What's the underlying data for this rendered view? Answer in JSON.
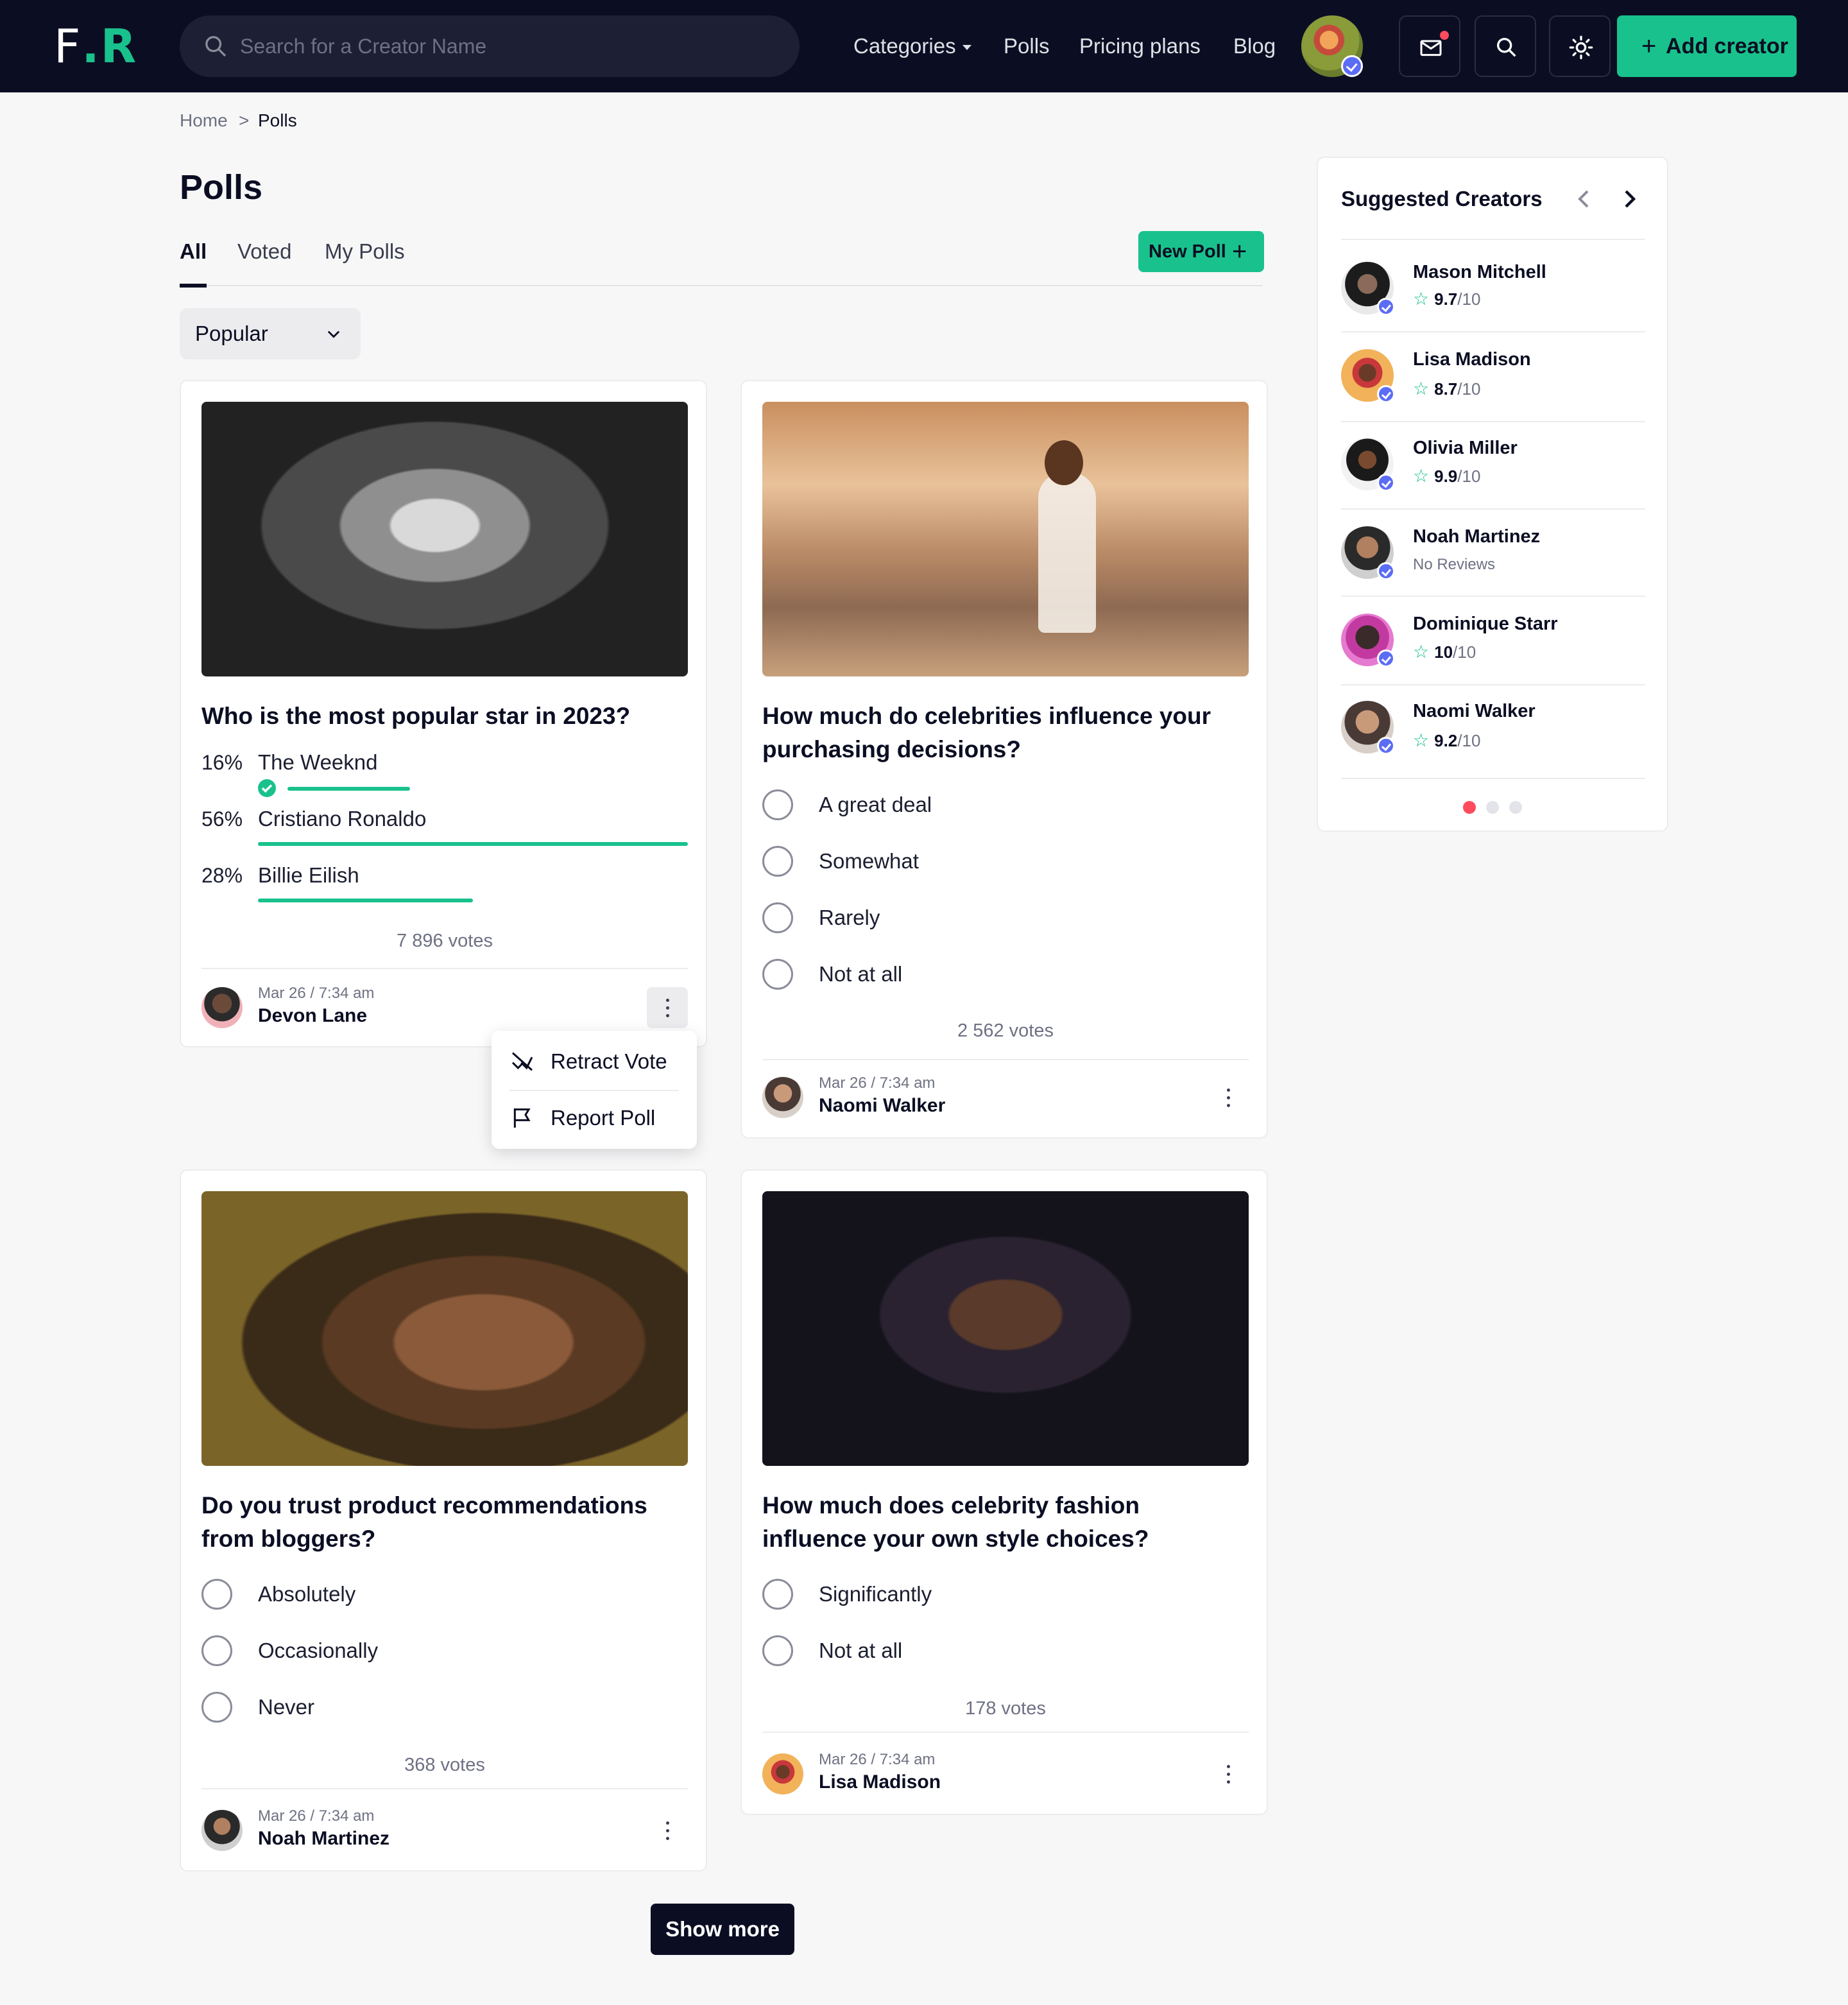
{
  "header": {
    "logo_f": "F",
    "logo_dot": ".",
    "logo_r": "R",
    "search_placeholder": "Search for a Creator Name",
    "nav": [
      {
        "label": "Categories"
      },
      {
        "label": "Polls"
      },
      {
        "label": "Pricing plans"
      },
      {
        "label": "Blog"
      }
    ],
    "add_creator_plus": "+",
    "add_creator_label": "Add creator",
    "icons": [
      "mail-icon",
      "search-icon",
      "theme-sun-icon"
    ],
    "accent": "#19c28c",
    "bg": "#0b0e23"
  },
  "breadcrumb": {
    "home": "Home",
    "separator": ">",
    "current": "Polls"
  },
  "page": {
    "title": "Polls",
    "tabs": [
      {
        "label": "All"
      },
      {
        "label": "Voted"
      },
      {
        "label": "My Polls"
      }
    ],
    "active_tab": "All",
    "new_poll_label": "New Poll",
    "new_poll_plus": "+",
    "sort": {
      "selected": "Popular"
    }
  },
  "polls": [
    {
      "question": "Who is the most popular star in 2023?",
      "voted": true,
      "results": [
        {
          "pct": "16%",
          "label": "The Weeknd",
          "value": 16,
          "my_vote": true
        },
        {
          "pct": "56%",
          "label": "Cristiano Ronaldo",
          "value": 56
        },
        {
          "pct": "28%",
          "label": "Billie Eilish",
          "value": 28
        }
      ],
      "votes": "7 896 votes",
      "date": "Mar 26 / 7:34 am",
      "author": "Devon Lane"
    },
    {
      "question": "How much do celebrities influence your purchasing decisions?",
      "options": [
        "A great deal",
        "Somewhat",
        "Rarely",
        "Not at all"
      ],
      "votes": "2 562 votes",
      "date": "Mar 26 / 7:34 am",
      "author": "Naomi Walker"
    },
    {
      "question": "Do you trust product recommendations from bloggers?",
      "options": [
        "Absolutely",
        "Occasionally",
        "Never"
      ],
      "votes": "368 votes",
      "date": "Mar 26 / 7:34 am",
      "author": "Noah Martinez"
    },
    {
      "question": "How much does celebrity fashion influence your own style choices?",
      "options": [
        "Significantly",
        "Not at all"
      ],
      "votes": "178 votes",
      "date": "Mar 26 / 7:34 am",
      "author": "Lisa Madison"
    }
  ],
  "context_menu": {
    "retract": "Retract Vote",
    "report": "Report Poll"
  },
  "suggested": {
    "title": "Suggested Creators",
    "creators": [
      {
        "name": "Mason Mitchell",
        "rating": "9.7",
        "of": "/10"
      },
      {
        "name": "Lisa Madison",
        "rating": "8.7",
        "of": "/10"
      },
      {
        "name": "Olivia Miller",
        "rating": "9.9",
        "of": "/10"
      },
      {
        "name": "Noah Martinez",
        "no_reviews": "No Reviews"
      },
      {
        "name": "Dominique Starr",
        "rating": "10",
        "of": "/10"
      },
      {
        "name": "Naomi Walker",
        "rating": "9.2",
        "of": "/10"
      }
    ],
    "page_count": 3,
    "active_page": 1
  },
  "show_more": "Show more"
}
